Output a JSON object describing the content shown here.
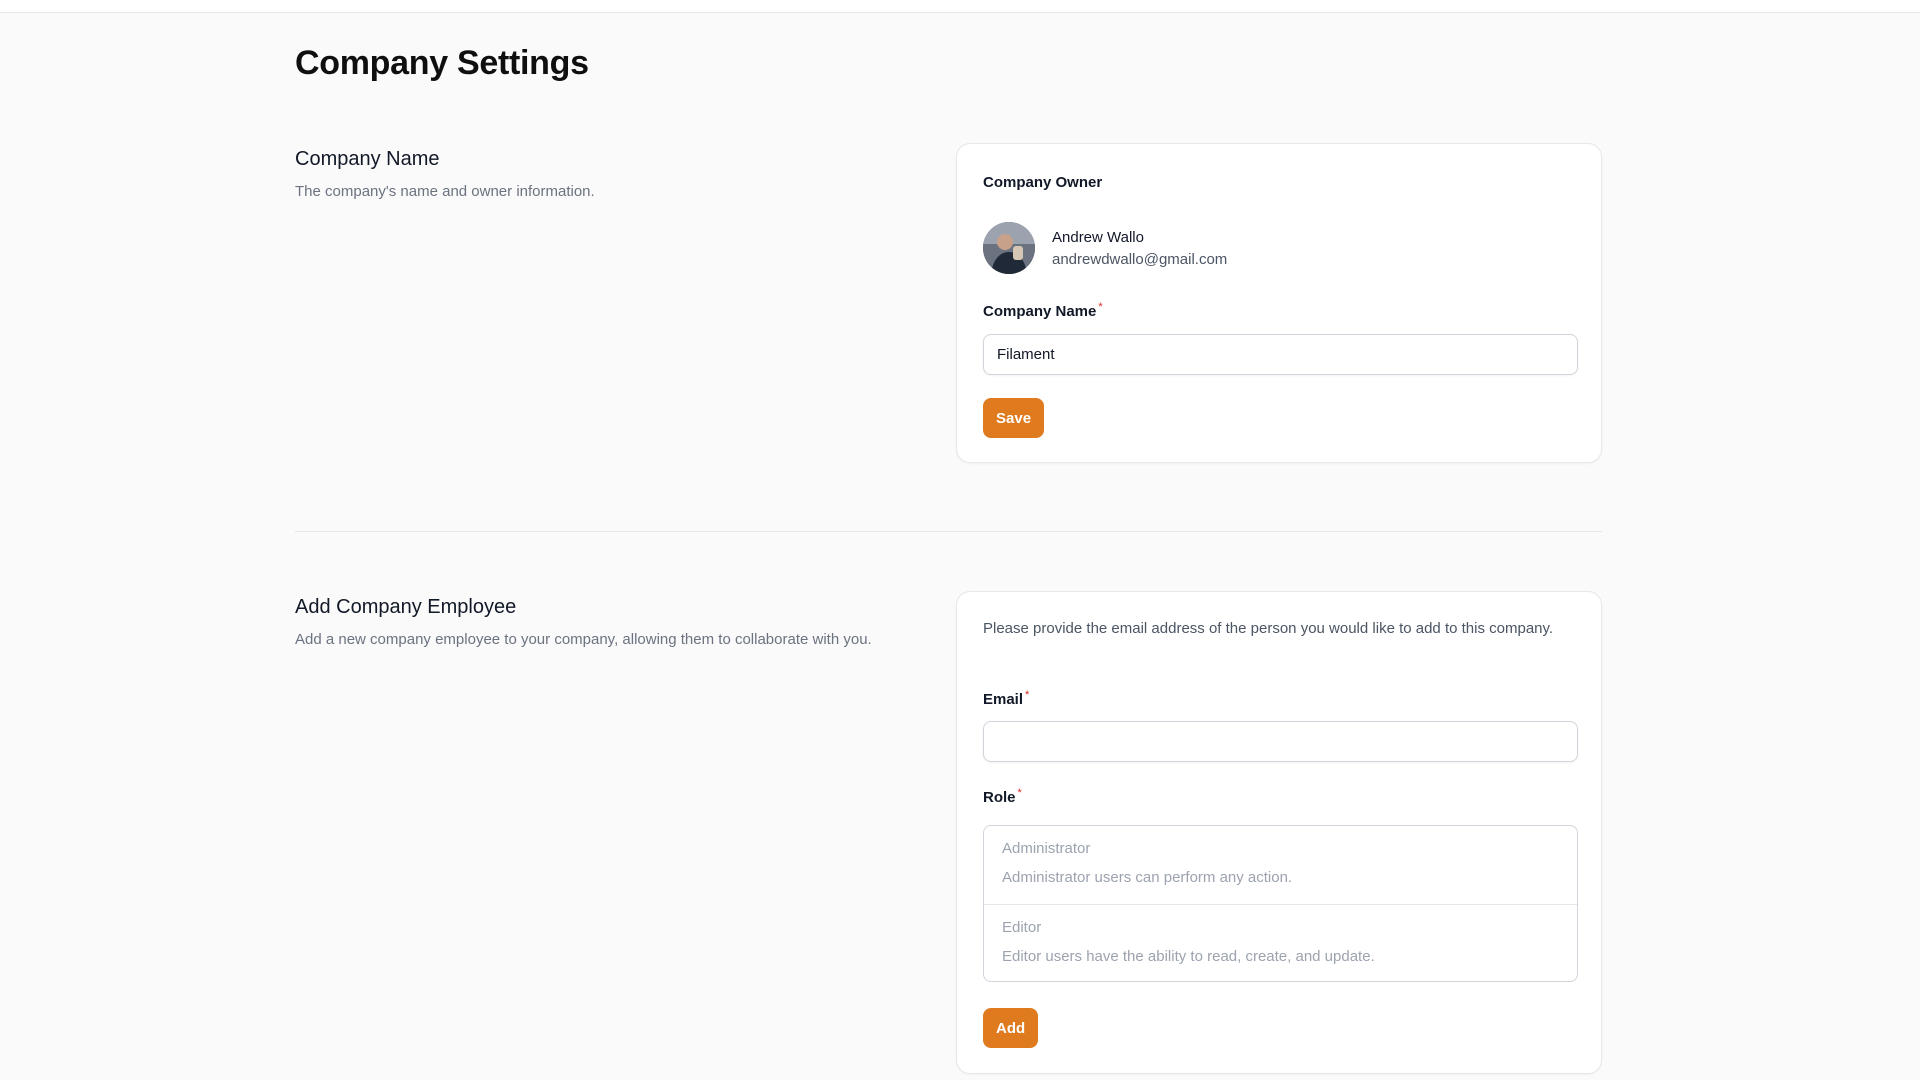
{
  "page": {
    "title": "Company Settings"
  },
  "company_name_section": {
    "heading": "Company Name",
    "description": "The company's name and owner information.",
    "owner_label": "Company Owner",
    "owner": {
      "name": "Andrew Wallo",
      "email": "andrewdwallo@gmail.com"
    },
    "name_field": {
      "label": "Company Name",
      "required_mark": "*",
      "value": "Filament"
    },
    "save_label": "Save"
  },
  "add_employee_section": {
    "heading": "Add Company Employee",
    "description": "Add a new company employee to your company, allowing them to collaborate with you.",
    "intro": "Please provide the email address of the person you would like to add to this company.",
    "email_field": {
      "label": "Email",
      "required_mark": "*",
      "value": ""
    },
    "role_field": {
      "label": "Role",
      "required_mark": "*",
      "options": [
        {
          "name": "Administrator",
          "description": "Administrator users can perform any action."
        },
        {
          "name": "Editor",
          "description": "Editor users have the ability to read, create, and update."
        }
      ]
    },
    "add_label": "Add"
  },
  "colors": {
    "accent": "#e07a1f",
    "required": "#dc2626",
    "background": "#fafafa"
  }
}
